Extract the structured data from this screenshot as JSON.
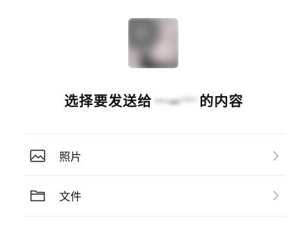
{
  "title": {
    "prefix": "选择要发送给",
    "suffix": "的内容"
  },
  "options": [
    {
      "label": "照片",
      "icon": "image-icon"
    },
    {
      "label": "文件",
      "icon": "folder-icon"
    }
  ],
  "colors": {
    "text": "#111111",
    "icon": "#222222",
    "chevron": "#b5b5b5",
    "divider": "#ececec"
  }
}
